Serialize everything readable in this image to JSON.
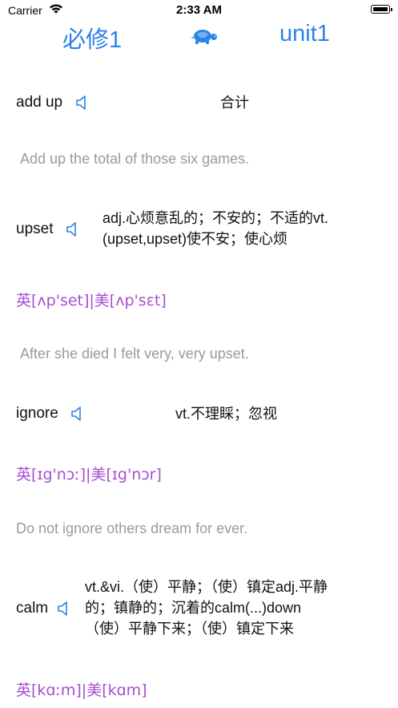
{
  "status_bar": {
    "carrier": "Carrier",
    "time": "2:33 AM"
  },
  "nav": {
    "left_title": "必修1",
    "center_icon": "turtle-icon",
    "right_title": "unit1"
  },
  "entries": [
    {
      "word": "add up",
      "meaning": "合计",
      "example": "Add up the total of those six games."
    },
    {
      "word": "upset",
      "meaning_lines": [
        "adj.心烦意乱的；不安的；不适的vt.",
        "(upset,upset)使不安；使心烦"
      ],
      "phonetic": "英[ʌp'set]|美[ʌp'sɛt]",
      "example": "After she died I felt very, very upset."
    },
    {
      "word": "ignore",
      "meaning": "vt.不理睬；忽视",
      "phonetic": "英[ɪg'nɔː]|美[ɪg'nɔr]",
      "example": "Do not ignore others dream for ever."
    },
    {
      "word": "calm",
      "meaning_lines": [
        "vt.&vi.（使）平静；（使）镇定adj.平静",
        "的；镇静的；沉着的calm(...)down",
        "（使）平静下来；（使）镇定下来"
      ],
      "phonetic": "英[kɑːm]|美[kɑm]"
    }
  ],
  "colors": {
    "accent": "#2c84e8",
    "phonetic": "#a64fd0",
    "example": "#9a9a9a"
  },
  "icons": {
    "speaker": "speaker-icon",
    "wifi": "wifi-icon",
    "battery": "battery-icon"
  }
}
